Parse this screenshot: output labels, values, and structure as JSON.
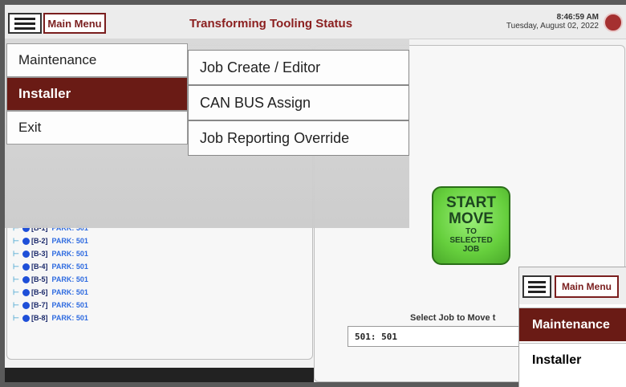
{
  "header": {
    "main_menu_label": "Main Menu",
    "title": "Transforming Tooling Status",
    "time": "8:46:59 AM",
    "date": "Tuesday, August 02, 2022"
  },
  "menu": {
    "primary": [
      {
        "label": "Maintenance",
        "active": false
      },
      {
        "label": "Installer",
        "active": true
      },
      {
        "label": "Exit",
        "active": false
      }
    ],
    "submenu": [
      {
        "label": "Job Create / Editor"
      },
      {
        "label": "CAN BUS Assign"
      },
      {
        "label": "Job Reporting Override"
      }
    ]
  },
  "stations": [
    {
      "id": "[B-1]",
      "status": "PARK: 501"
    },
    {
      "id": "[B-2]",
      "status": "PARK: 501"
    },
    {
      "id": "[B-3]",
      "status": "PARK: 501"
    },
    {
      "id": "[B-4]",
      "status": "PARK: 501"
    },
    {
      "id": "[B-5]",
      "status": "PARK: 501"
    },
    {
      "id": "[B-6]",
      "status": "PARK: 501"
    },
    {
      "id": "[B-7]",
      "status": "PARK: 501"
    },
    {
      "id": "[B-8]",
      "status": "PARK: 501"
    }
  ],
  "start_button": {
    "line1": "START",
    "line2": "MOVE",
    "line3": "TO",
    "line4": "SELECTED",
    "line5": "JOB"
  },
  "job_select": {
    "label": "Select Job to Move t",
    "value": "501:  501"
  },
  "inset": {
    "main_menu_label": "Main Menu",
    "items": [
      {
        "label": "Maintenance",
        "active": true
      },
      {
        "label": "Installer",
        "active": false
      }
    ]
  },
  "colors": {
    "brand": "#7a1e1e",
    "active_menu": "#6a1b15",
    "start_green": "#66cf3d",
    "station_dot": "#1e4fd8"
  }
}
